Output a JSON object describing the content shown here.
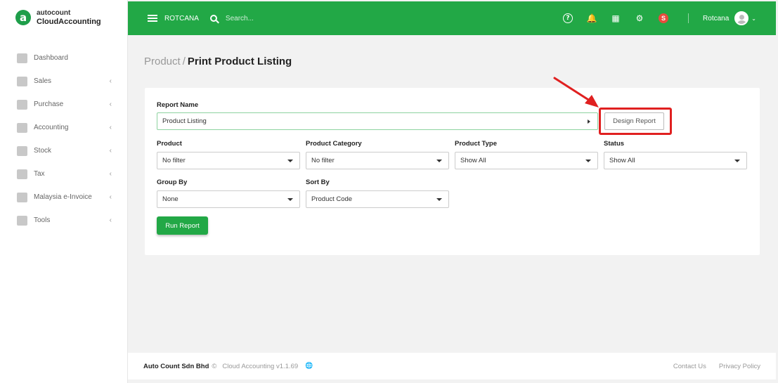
{
  "app": {
    "logo_top": "autocount",
    "logo_bottom": "CloudAccounting",
    "logo_letter": "a"
  },
  "sidebar": {
    "items": [
      {
        "label": "Dashboard",
        "icon": "dashboard-icon",
        "chevron": ""
      },
      {
        "label": "Sales",
        "icon": "sales-icon",
        "chevron": "‹"
      },
      {
        "label": "Purchase",
        "icon": "purchase-icon",
        "chevron": "‹"
      },
      {
        "label": "Accounting",
        "icon": "accounting-icon",
        "chevron": "‹"
      },
      {
        "label": "Stock",
        "icon": "stock-icon",
        "chevron": "‹"
      },
      {
        "label": "Tax",
        "icon": "tax-icon",
        "chevron": "‹"
      },
      {
        "label": "Malaysia e-Invoice",
        "icon": "einvoice-icon",
        "chevron": "‹"
      },
      {
        "label": "Tools",
        "icon": "tools-icon",
        "chevron": "‹"
      }
    ]
  },
  "topbar": {
    "company": "ROTCANA",
    "search_placeholder": "Search...",
    "help_glyph": "?",
    "bell_glyph": "🔔",
    "apps_glyph": "▦",
    "gear_glyph": "⚙",
    "badge": "S",
    "user": "Rotcana",
    "user_chevron": "⌄"
  },
  "breadcrumb": {
    "parent": "Product",
    "separator": "/",
    "current": "Print Product Listing"
  },
  "form": {
    "report_name_label": "Report Name",
    "report_name_value": "Product Listing",
    "design_report_label": "Design Report",
    "product_label": "Product",
    "product_value": "No filter",
    "category_label": "Product Category",
    "category_value": "No filter",
    "type_label": "Product Type",
    "type_value": "Show All",
    "status_label": "Status",
    "status_value": "Show All",
    "group_label": "Group By",
    "group_value": "None",
    "sort_label": "Sort By",
    "sort_value": "Product Code",
    "run_label": "Run Report"
  },
  "footer": {
    "company": "Auto Count Sdn Bhd",
    "copyright": "©",
    "version": "Cloud Accounting v1.1.69",
    "globe": "🌐",
    "contact": "Contact Us",
    "privacy": "Privacy Policy"
  },
  "colors": {
    "brand_green": "#22a846",
    "highlight_red": "#e02020"
  }
}
